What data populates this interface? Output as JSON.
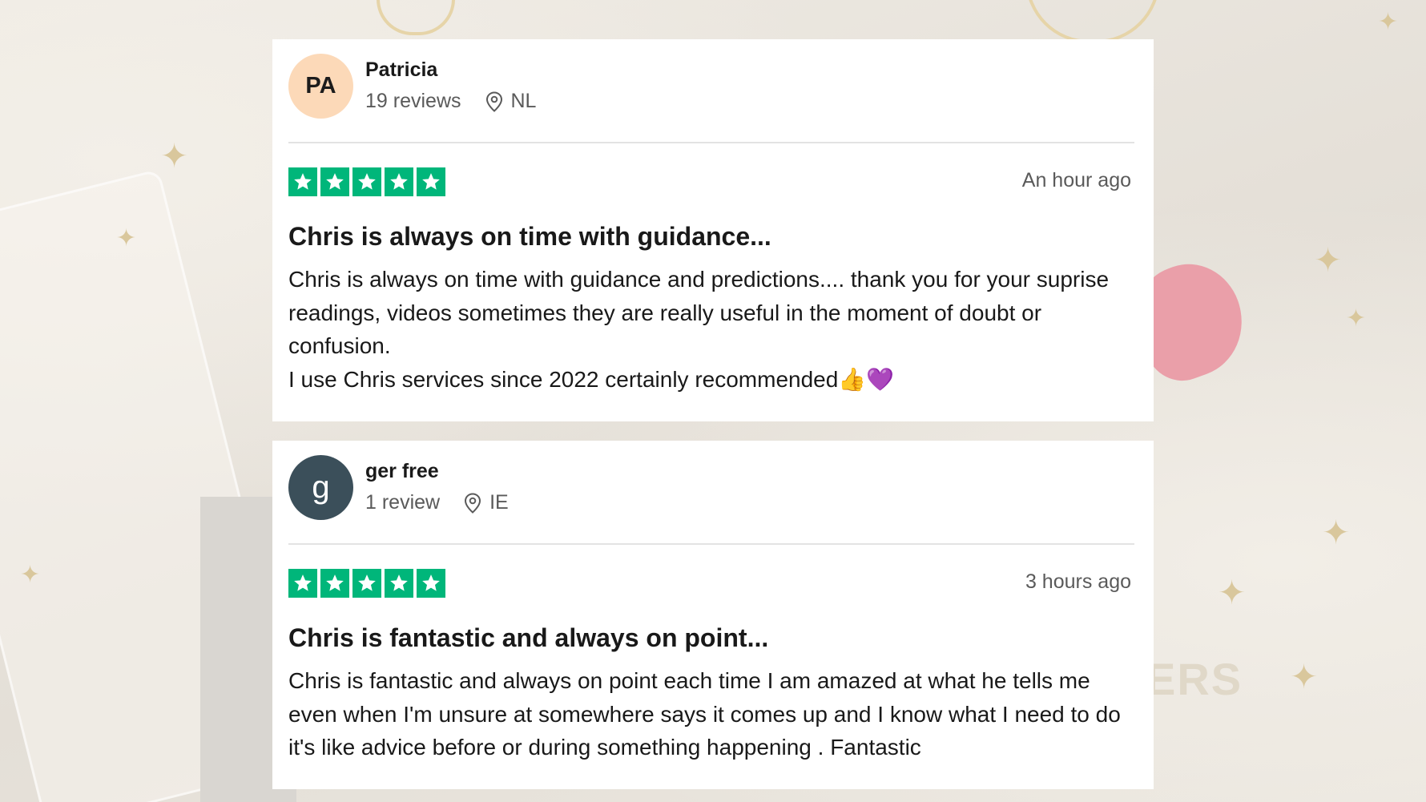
{
  "reviews": [
    {
      "avatar_text": "PA",
      "avatar_color": "#fcd9b8",
      "name": "Patricia",
      "review_count": "19 reviews",
      "country": "NL",
      "rating": 5,
      "date": "An hour ago",
      "title": "Chris is always on time with guidance...",
      "body_lines": [
        "Chris is always on time with guidance and predictions.... thank you for your suprise readings, videos sometimes they are really useful in the moment of doubt or confusion.",
        "I use Chris services since 2022 certainly recommended👍💜"
      ]
    },
    {
      "avatar_text": "g",
      "avatar_color": "#3b4f5a",
      "name": "ger free",
      "review_count": "1 review",
      "country": "IE",
      "rating": 5,
      "date": "3 hours ago",
      "title": "Chris is fantastic and always on point...",
      "body_lines": [
        "Chris is fantastic and always on point each time I am amazed at what he tells me even when I'm unsure at somewhere says it comes up and I know what I need to do it's like advice before or during something happening . Fantastic"
      ]
    }
  ],
  "colors": {
    "star_green": "#00b67a"
  },
  "icons": {
    "location": "location-pin-icon",
    "star": "star-icon"
  }
}
